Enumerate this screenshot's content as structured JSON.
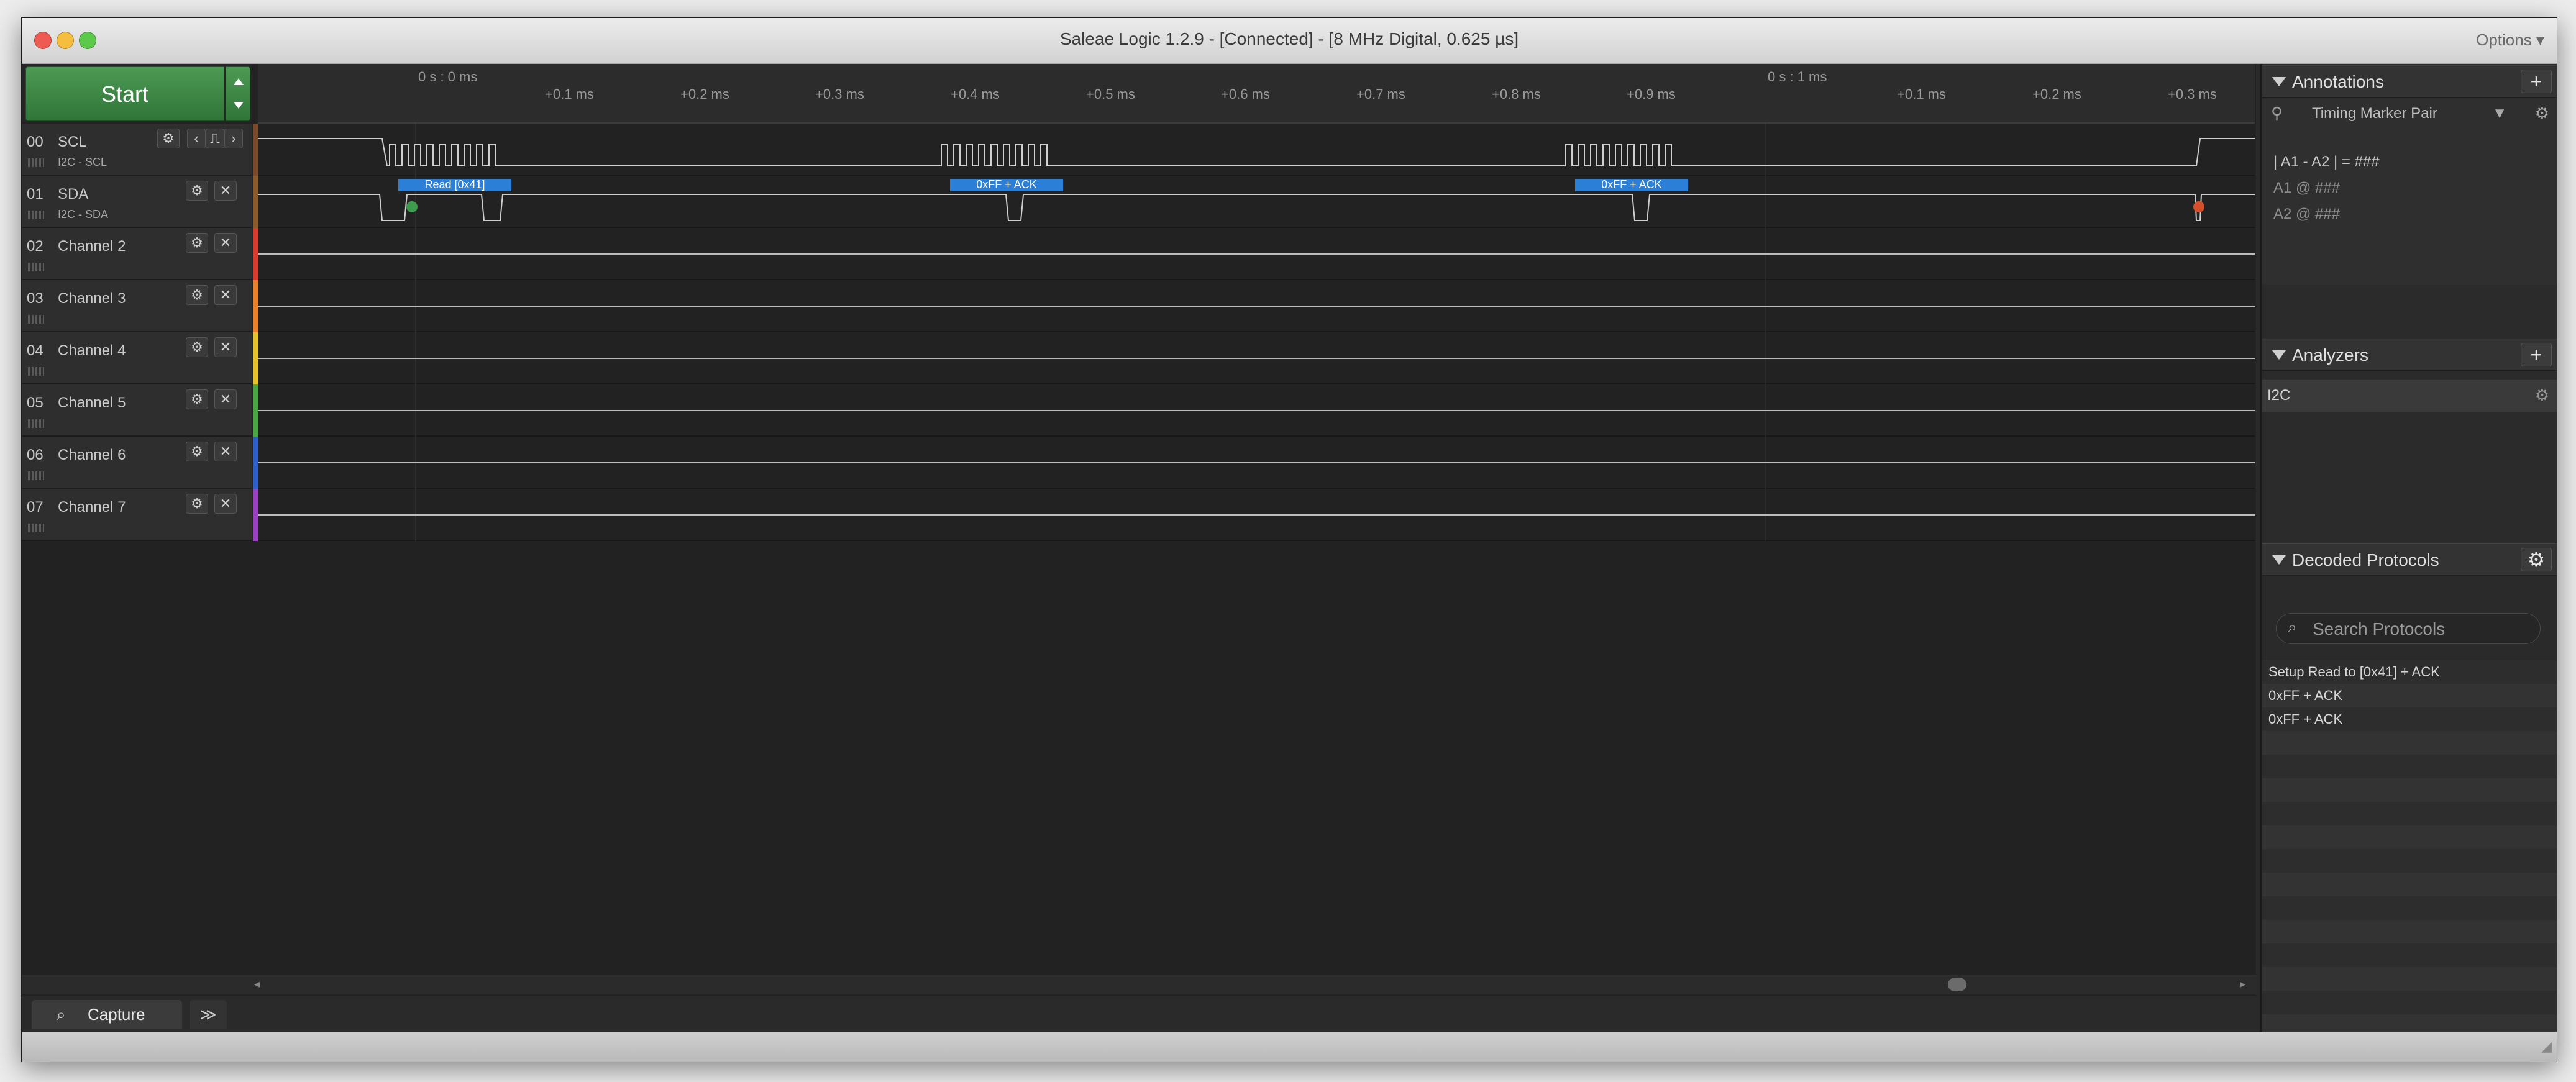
{
  "app": {
    "title": "Saleae Logic 1.2.9 - [Connected] - [8 MHz Digital, 0.625 µs]",
    "options_label": "Options ▾"
  },
  "toolbar": {
    "start_label": "Start"
  },
  "ruler": {
    "majors": [
      "0 s : 0 ms",
      "0 s : 1 ms"
    ],
    "ticks": [
      "+0.1 ms",
      "+0.2 ms",
      "+0.3 ms",
      "+0.4 ms",
      "+0.5 ms",
      "+0.6 ms",
      "+0.7 ms",
      "+0.8 ms",
      "+0.9 ms",
      "+0.1 ms",
      "+0.2 ms",
      "+0.3 ms"
    ]
  },
  "channels": [
    {
      "num": "00",
      "name": "SCL",
      "sub": "I2C - SCL",
      "color": "#7a4a2a"
    },
    {
      "num": "01",
      "name": "SDA",
      "sub": "I2C - SDA",
      "color": "#8a5a2a"
    },
    {
      "num": "02",
      "name": "Channel 2",
      "sub": "",
      "color": "#d93a2b"
    },
    {
      "num": "03",
      "name": "Channel 3",
      "sub": "",
      "color": "#e8812a"
    },
    {
      "num": "04",
      "name": "Channel 4",
      "sub": "",
      "color": "#e5c22a"
    },
    {
      "num": "05",
      "name": "Channel 5",
      "sub": "",
      "color": "#4aa843"
    },
    {
      "num": "06",
      "name": "Channel 6",
      "sub": "",
      "color": "#2f5fc8"
    },
    {
      "num": "07",
      "name": "Channel 7",
      "sub": "",
      "color": "#9a3fc1"
    }
  ],
  "decoded_labels": [
    "Read [0x41]",
    "0xFF + ACK",
    "0xFF + ACK"
  ],
  "tabs": {
    "capture_label": "Capture",
    "more_label": "≫"
  },
  "annotations": {
    "title": "Annotations",
    "add_label": "+",
    "marker_label": "Timing Marker Pair",
    "line1": "| A1 - A2 | = ###",
    "line2": "A1  @  ###",
    "line3": "A2  @  ###"
  },
  "analyzers": {
    "title": "Analyzers",
    "add_label": "+",
    "items": [
      "I2C"
    ]
  },
  "decoded": {
    "title": "Decoded Protocols",
    "search_placeholder": "Search Protocols",
    "items": [
      "Setup Read to [0x41] + ACK",
      "0xFF + ACK",
      "0xFF + ACK"
    ]
  },
  "icons": {
    "gear": "gear-icon",
    "close": "close-icon",
    "search": "search-icon",
    "pin": "pin-icon",
    "chevron": "chevron-down-icon"
  },
  "colors": {
    "start_green": "#3c8a44",
    "decode_blue": "#2b7fd6",
    "wave": "#d0d0d0"
  }
}
